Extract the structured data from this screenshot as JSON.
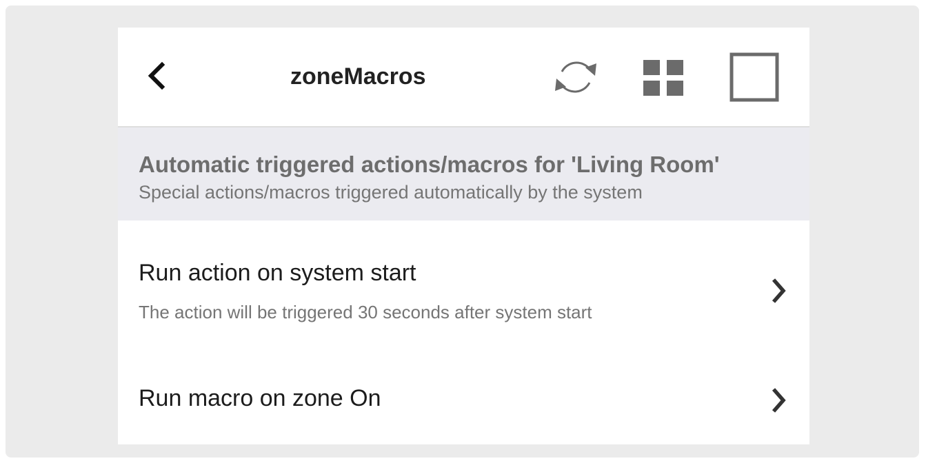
{
  "header": {
    "back_icon": "chevron-left-icon",
    "title": "zoneMacros",
    "refresh_icon": "refresh-icon",
    "grid_icon": "grid-icon",
    "square_icon": "square-icon"
  },
  "section": {
    "title": "Automatic triggered actions/macros for 'Living Room'",
    "subtitle": "Special actions/macros triggered automatically by the system"
  },
  "items": [
    {
      "title": "Run action on system start",
      "subtitle": "The action will be triggered 30 seconds after system start",
      "icon": "chevron-right-icon"
    },
    {
      "title": "Run macro on zone On",
      "subtitle": "",
      "icon": "chevron-right-icon"
    }
  ],
  "colors": {
    "background": "#ebebeb",
    "panel": "#ffffff",
    "section_bg": "#ebebf0",
    "icon": "#6b6b6b",
    "text": "#1c1c1c",
    "muted": "#757575"
  }
}
